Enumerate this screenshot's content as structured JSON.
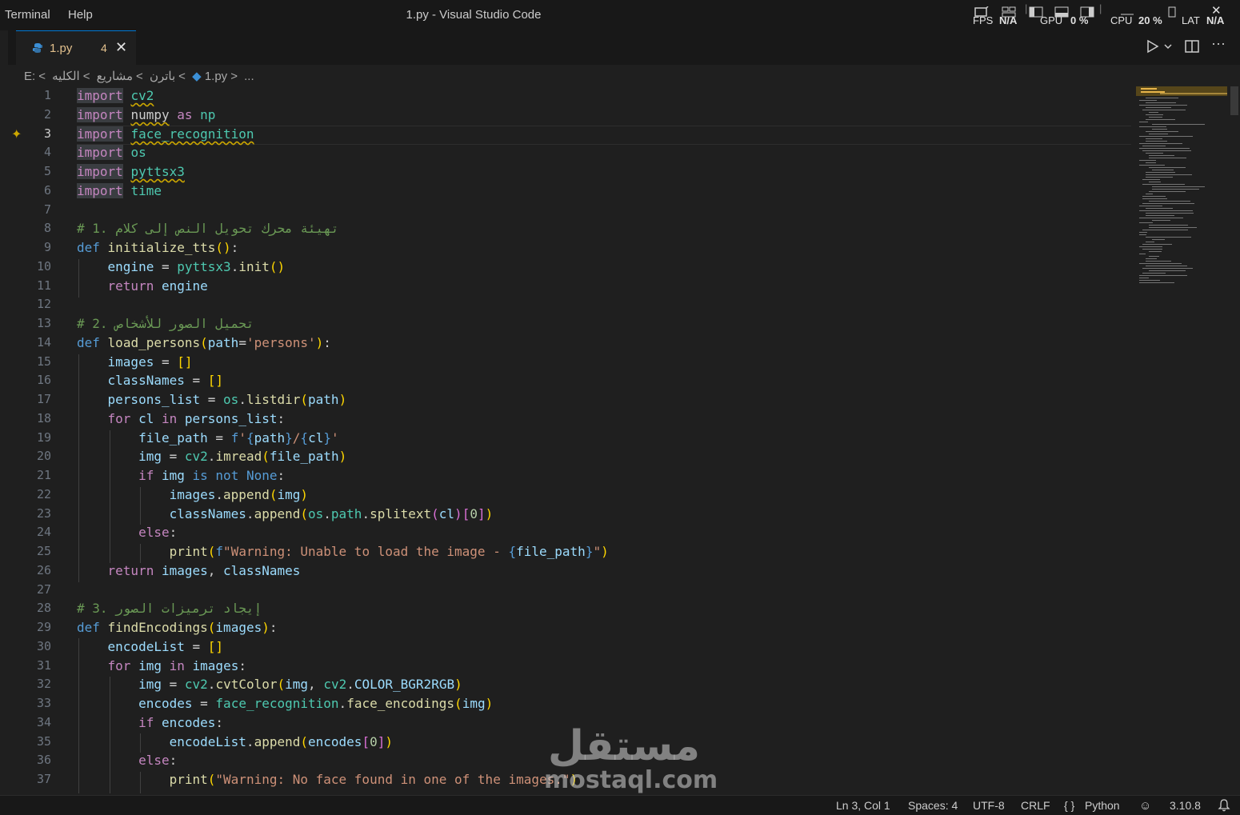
{
  "menu": [
    "Terminal",
    "Help"
  ],
  "window_title": "1.py - Visual Studio Code",
  "perf": {
    "fps_label": "FPS",
    "fps_value": "N/A",
    "gpu_label": "GPU",
    "gpu_value": "0 %",
    "cpu_label": "CPU",
    "cpu_value": "20 %",
    "lat_label": "LAT",
    "lat_value": "N/A"
  },
  "tab": {
    "name": "1.py",
    "problems": "4",
    "icon": "python-file-icon"
  },
  "breadcrumb": [
    "E:",
    "الكليه",
    "مشاريع",
    "باترن",
    "1.py",
    "..."
  ],
  "editor": {
    "active_line": 3,
    "lines": [
      {
        "n": "1"
      },
      {
        "n": "2"
      },
      {
        "n": "3"
      },
      {
        "n": "4"
      },
      {
        "n": "5"
      },
      {
        "n": "6"
      },
      {
        "n": "7"
      },
      {
        "n": "8"
      },
      {
        "n": "9"
      },
      {
        "n": "10"
      },
      {
        "n": "11"
      },
      {
        "n": "12"
      },
      {
        "n": "13"
      },
      {
        "n": "14"
      },
      {
        "n": "15"
      },
      {
        "n": "16"
      },
      {
        "n": "17"
      },
      {
        "n": "18"
      },
      {
        "n": "19"
      },
      {
        "n": "20"
      },
      {
        "n": "21"
      },
      {
        "n": "22"
      },
      {
        "n": "23"
      },
      {
        "n": "24"
      },
      {
        "n": "25"
      },
      {
        "n": "26"
      },
      {
        "n": "27"
      },
      {
        "n": "28"
      },
      {
        "n": "29"
      },
      {
        "n": "30"
      },
      {
        "n": "31"
      },
      {
        "n": "32"
      },
      {
        "n": "33"
      },
      {
        "n": "34"
      },
      {
        "n": "35"
      },
      {
        "n": "36"
      },
      {
        "n": "37"
      }
    ],
    "comments": {
      "c8_num": "# 1. ",
      "c8_text": "تهيئة محرك تحويل النص إلى كلام",
      "c13_num": "# 2. ",
      "c13_text": "تحميل الصور للأشخاص",
      "c28_num": "# 3. ",
      "c28_text": "إيجاد ترميزات الصور"
    },
    "strings": {
      "persons": "'persons'",
      "warn_load": "\"Warning: Unable to load the image - ",
      "warn_face": "\"Warning: No face found in one of the images.\""
    }
  },
  "status": {
    "position": "Ln 3, Col 1",
    "spaces": "Spaces: 4",
    "encoding": "UTF-8",
    "eol": "CRLF",
    "language": "Python",
    "version": "3.10.8"
  },
  "watermark": {
    "ar": "مستقل",
    "en": "mostaql.com"
  },
  "colors": {
    "keyword": "#c586c0",
    "module": "#4ec9b0",
    "function": "#dcdcaa",
    "variable": "#9cdcfe",
    "string": "#ce9178",
    "comment": "#6a9955",
    "accent": "#0078d4"
  }
}
